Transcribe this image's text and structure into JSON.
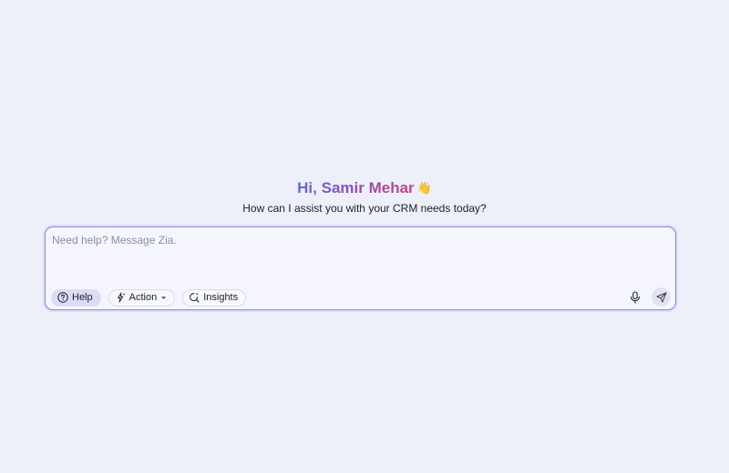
{
  "greeting": {
    "text": "Hi, Samir Mehar",
    "emoji": "👋",
    "gradient_colors": [
      "#5b6ae0",
      "#8a4fc2",
      "#c4457a"
    ]
  },
  "subtitle": "How can I assist you with your CRM needs today?",
  "composer": {
    "placeholder": "Need help? Message Zia.",
    "value": "",
    "border_color": "#8b87ea",
    "chips": [
      {
        "label": "Help",
        "icon": "help-circle-icon",
        "selected": true
      },
      {
        "label": "Action",
        "icon": "sparkle-bolt-icon",
        "has_dropdown": true,
        "selected": false
      },
      {
        "label": "Insights",
        "icon": "insights-search-icon",
        "selected": false
      }
    ],
    "mic_icon": "microphone-icon",
    "send_icon": "send-paper-plane-icon"
  },
  "colors": {
    "background": "#eef0f9",
    "accent": "#8b87ea",
    "chip_selected_bg": "#dcdcf6"
  }
}
